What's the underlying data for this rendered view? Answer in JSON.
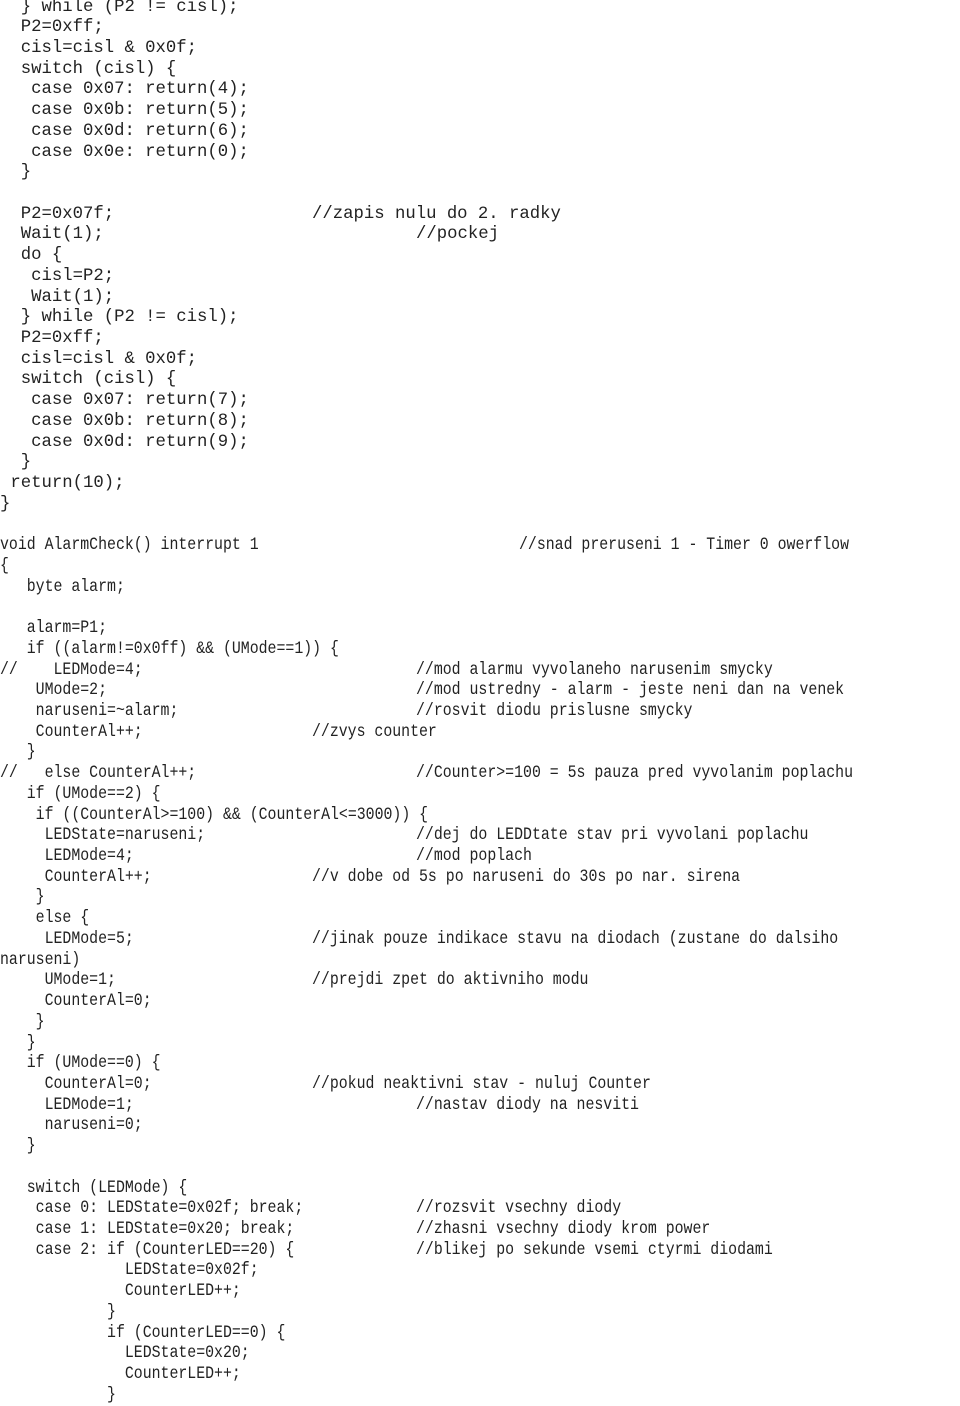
{
  "document": {
    "type": "source-code-listing",
    "language": "C (8051)",
    "lines": [
      {
        "code": "  } while (P2 != cisl);",
        "comment": ""
      },
      {
        "code": "  P2=0xff;",
        "comment": ""
      },
      {
        "code": "  cisl=cisl & 0x0f;",
        "comment": ""
      },
      {
        "code": "  switch (cisl) {",
        "comment": ""
      },
      {
        "code": "   case 0x07: return(4);",
        "comment": ""
      },
      {
        "code": "   case 0x0b: return(5);",
        "comment": ""
      },
      {
        "code": "   case 0x0d: return(6);",
        "comment": ""
      },
      {
        "code": "   case 0x0e: return(0);",
        "comment": ""
      },
      {
        "code": "  }",
        "comment": ""
      },
      {
        "code": "",
        "comment": ""
      },
      {
        "code": "  P2=0x07f;",
        "comment": "//zapis nulu do 2. radky"
      },
      {
        "code": "  Wait(1);",
        "comment": "//pockej"
      },
      {
        "code": "  do {",
        "comment": ""
      },
      {
        "code": "   cisl=P2;",
        "comment": ""
      },
      {
        "code": "   Wait(1);",
        "comment": ""
      },
      {
        "code": "  } while (P2 != cisl);",
        "comment": ""
      },
      {
        "code": "  P2=0xff;",
        "comment": ""
      },
      {
        "code": "  cisl=cisl & 0x0f;",
        "comment": ""
      },
      {
        "code": "  switch (cisl) {",
        "comment": ""
      },
      {
        "code": "   case 0x07: return(7);",
        "comment": ""
      },
      {
        "code": "   case 0x0b: return(8);",
        "comment": ""
      },
      {
        "code": "   case 0x0d: return(9);",
        "comment": ""
      },
      {
        "code": "  }",
        "comment": ""
      },
      {
        "code": " return(10);",
        "comment": ""
      },
      {
        "code": "}",
        "comment": ""
      },
      {
        "code": "",
        "comment": ""
      },
      {
        "code": "void AlarmCheck() interrupt 1",
        "comment": "//snad preruseni 1 - Timer 0 owerflow"
      },
      {
        "code": "{",
        "comment": ""
      },
      {
        "code": "   byte alarm;",
        "comment": ""
      },
      {
        "code": "",
        "comment": ""
      },
      {
        "code": "   alarm=P1;",
        "comment": ""
      },
      {
        "code": "   if ((alarm!=0x0ff) && (UMode==1)) {",
        "comment": ""
      },
      {
        "code": "//    LEDMode=4;",
        "comment": "//mod alarmu vyvolaneho narusenim smycky"
      },
      {
        "code": "    UMode=2;",
        "comment": "//mod ustredny - alarm - jeste neni dan na venek"
      },
      {
        "code": "    naruseni=~alarm;",
        "comment": "//rosvit diodu prislusne smycky"
      },
      {
        "code": "    CounterAl++;",
        "comment": "//zvys counter"
      },
      {
        "code": "   }",
        "comment": ""
      },
      {
        "code": "//   else CounterAl++;",
        "comment": "//Counter>=100 = 5s pauza pred vyvolanim poplachu"
      },
      {
        "code": "   if (UMode==2) {",
        "comment": ""
      },
      {
        "code": "    if ((CounterAl>=100) && (CounterAl<=3000)) {",
        "comment": ""
      },
      {
        "code": "     LEDState=naruseni;",
        "comment": "//dej do LEDDtate stav pri vyvolani poplachu"
      },
      {
        "code": "     LEDMode=4;",
        "comment": "//mod poplach"
      },
      {
        "code": "     CounterAl++;",
        "comment": "//v dobe od 5s po naruseni do 30s po nar. sirena"
      },
      {
        "code": "    }",
        "comment": ""
      },
      {
        "code": "    else {",
        "comment": ""
      },
      {
        "code": "     LEDMode=5;",
        "comment": "//jinak pouze indikace stavu na diodach (zustane do dalsiho"
      },
      {
        "code": "naruseni)",
        "comment": ""
      },
      {
        "code": "     UMode=1;",
        "comment": "//prejdi zpet do aktivniho modu"
      },
      {
        "code": "     CounterAl=0;",
        "comment": ""
      },
      {
        "code": "    }",
        "comment": ""
      },
      {
        "code": "   }",
        "comment": ""
      },
      {
        "code": "   if (UMode==0) {",
        "comment": ""
      },
      {
        "code": "     CounterAl=0;",
        "comment": "//pokud neaktivni stav - nuluj Counter"
      },
      {
        "code": "     LEDMode=1;",
        "comment": "//nastav diody na nesviti"
      },
      {
        "code": "     naruseni=0;",
        "comment": ""
      },
      {
        "code": "   }",
        "comment": ""
      },
      {
        "code": "",
        "comment": ""
      },
      {
        "code": "   switch (LEDMode) {",
        "comment": ""
      },
      {
        "code": "    case 0: LEDState=0x02f; break;",
        "comment": "//rozsvit vsechny diody"
      },
      {
        "code": "    case 1: LEDState=0x20; break;",
        "comment": "//zhasni vsechny diody krom power"
      },
      {
        "code": "    case 2: if (CounterLED==20) {",
        "comment": "//blikej po sekunde vsemi ctyrmi diodami"
      },
      {
        "code": "              LEDState=0x02f;",
        "comment": ""
      },
      {
        "code": "              CounterLED++;",
        "comment": ""
      },
      {
        "code": "            }",
        "comment": ""
      },
      {
        "code": "            if (CounterLED==0) {",
        "comment": ""
      },
      {
        "code": "              LEDState=0x20;",
        "comment": ""
      },
      {
        "code": "              CounterLED++;",
        "comment": ""
      },
      {
        "code": "            }",
        "comment": ""
      }
    ]
  }
}
